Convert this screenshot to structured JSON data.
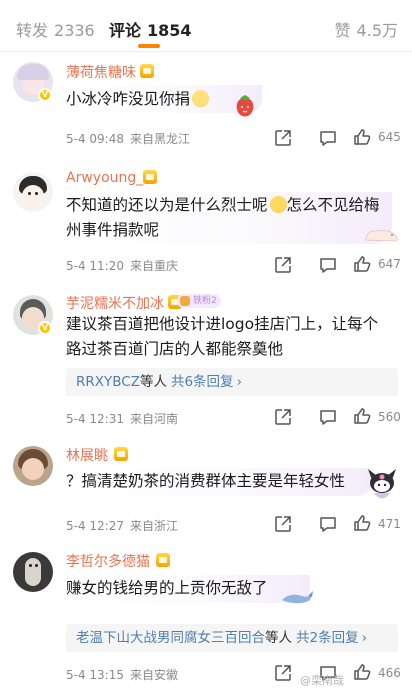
{
  "tabs": {
    "forward": {
      "label": "转发",
      "count": "2336"
    },
    "comment": {
      "label": "评论",
      "count": "1854"
    },
    "like": {
      "label": "赞",
      "count": "4.5万"
    }
  },
  "comments": [
    {
      "user": "薄荷焦糖味",
      "text": "小冰冷咋没见你捐",
      "date": "5-4 09:48",
      "location": "来自黑龙江",
      "likes": "645"
    },
    {
      "user": "Arwyoung_",
      "text_a": "不知道的还以为是什么烈士呢",
      "text_b": "怎么不见给梅州事件捐款呢",
      "date": "5-4 11:20",
      "location": "来自重庆",
      "likes": "647"
    },
    {
      "user": "芋泥糯米不加冰",
      "badge": "铁粉2",
      "text": "建议茶百道把他设计进logo挂店门上，让每个路过茶百道门店的人都能祭奠他",
      "replies": {
        "names": "RRXYBCZ",
        "plain": "等人",
        "count": "共6条回复",
        "chevron": "›"
      },
      "date": "5-4 12:31",
      "location": "来自河南",
      "likes": "560"
    },
    {
      "user": "林展眺",
      "text": "？搞清楚奶茶的消费群体主要是年轻女性",
      "date": "5-4 12:27",
      "location": "来自浙江",
      "likes": "471"
    },
    {
      "user": "李哲尔多德猫",
      "text": "赚女的钱给男的上贡你无敌了",
      "replies": {
        "names": "老温下山大战男同腐女三百回合",
        "plain": "等人",
        "count": "共2条回复",
        "chevron": "›"
      },
      "date": "5-4 13:15",
      "location": "来自安徽",
      "likes": "466"
    }
  ],
  "watermark": "@栾南哉",
  "colors": {
    "accent": "#ff8200",
    "username": "#eb7350",
    "reply_link": "#507daf",
    "meta": "#8a8a8a"
  },
  "icons": [
    "share-icon",
    "comment-icon",
    "like-icon",
    "crown-badge-icon",
    "verified-badge-icon"
  ]
}
